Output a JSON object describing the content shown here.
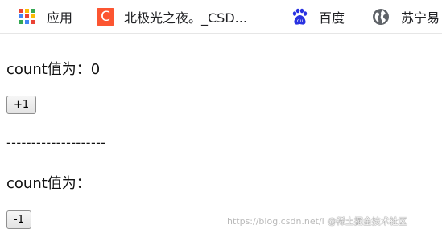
{
  "bookmarks": [
    {
      "label": "应用",
      "icon": "apps-grid-icon"
    },
    {
      "label": "北极光之夜。_CSD...",
      "icon": "csdn-icon",
      "icon_text": "C"
    },
    {
      "label": "百度",
      "icon": "baidu-paw-icon"
    },
    {
      "label": "苏宁易",
      "icon": "globe-icon"
    }
  ],
  "colors": {
    "csdn": "#fc5531",
    "baidu": "#2932e1",
    "apps": [
      "#ea4335",
      "#fbbc05",
      "#34a853",
      "#4285f4",
      "#ea4335",
      "#fbbc05",
      "#34a853",
      "#4285f4",
      "#ea4335"
    ]
  },
  "section1": {
    "count_text": "count值为：0",
    "button_label": "+1"
  },
  "divider": "--------------------",
  "section2": {
    "count_text": "count值为：",
    "button_label": "-1"
  },
  "watermark": {
    "url": "https://blog.csdn.net/l",
    "author": "@稀土掘金技术社区"
  }
}
